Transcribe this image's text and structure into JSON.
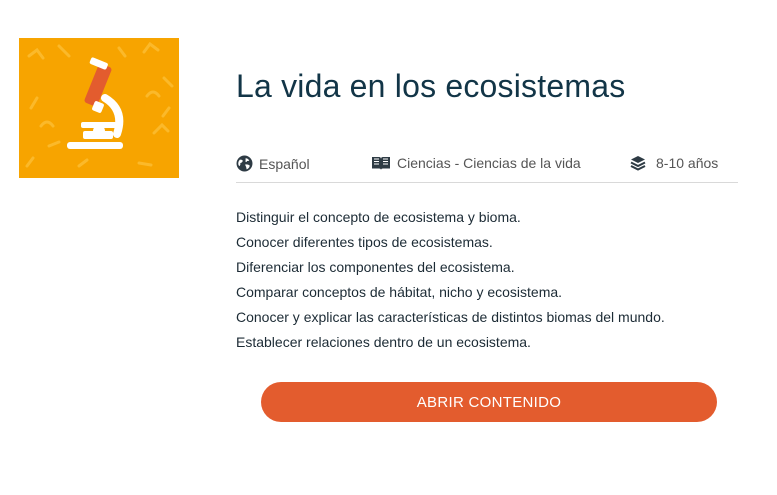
{
  "course": {
    "title": "La vida en los ecosistemas",
    "thumbnail_icon": "microscope-icon",
    "meta": {
      "language": "Español",
      "subject": "Ciencias - Ciencias de la vida",
      "age": "8-10 años"
    },
    "objectives": [
      "Distinguir el concepto de ecosistema y bioma.",
      "Conocer diferentes tipos de ecosistemas.",
      "Diferenciar los componentes del ecosistema.",
      "Comparar conceptos de hábitat, nicho y ecosistema.",
      "Conocer y explicar las características de distintos biomas del mundo.",
      "Establecer relaciones dentro de un ecosistema."
    ],
    "open_button_label": "ABRIR CONTENIDO"
  },
  "icons": {
    "language": "globe-icon",
    "subject": "book-icon",
    "age": "layers-icon"
  },
  "colors": {
    "thumbnail_bg": "#f7a400",
    "title": "#123547",
    "button": "#e35c2e",
    "button_text": "#ffffff"
  }
}
